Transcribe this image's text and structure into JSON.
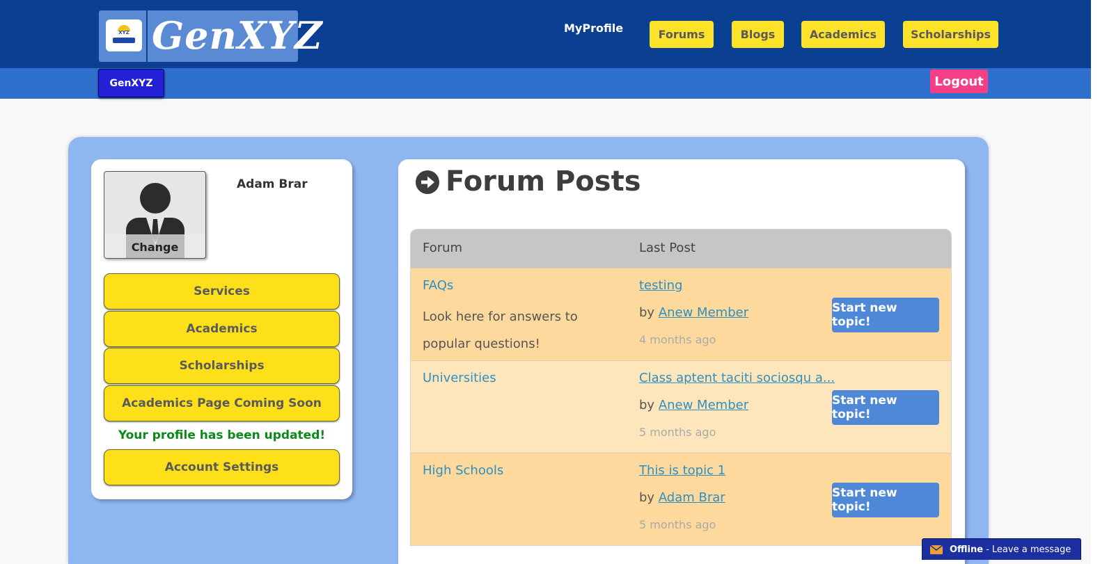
{
  "header": {
    "logo_text": "GenXYZ",
    "logo_badge_text": "XYZ",
    "nav_profile": "MyProfile",
    "nav_buttons": [
      "Forums",
      "Blogs",
      "Academics",
      "Scholarships"
    ],
    "home_button": "GenXYZ",
    "logout": "Logout"
  },
  "profile": {
    "name": "Adam Brar",
    "change_label": "Change",
    "menu": [
      "Services",
      "Academics",
      "Scholarships",
      "Academics Page Coming Soon"
    ],
    "status_message": "Your profile has been updated!",
    "settings_button": "Account Settings"
  },
  "forum": {
    "title": "Forum Posts",
    "columns": [
      "Forum",
      "Last Post"
    ],
    "rows": [
      {
        "name": "FAQs",
        "description": "Look here for answers to popular questions!",
        "last_post": "testing",
        "by_label": "by",
        "author": "Anew Member",
        "time": "4 months ago",
        "action": "Start new topic!"
      },
      {
        "name": "Universities",
        "description": "",
        "last_post": "Class aptent taciti sociosqu a...",
        "by_label": "by",
        "author": "Anew Member",
        "time": "5 months ago",
        "action": "Start new topic!"
      },
      {
        "name": "High Schools",
        "description": "",
        "last_post": "This is topic 1",
        "by_label": "by",
        "author": "Adam Brar",
        "time": "5 months ago",
        "action": "Start new topic!"
      }
    ]
  },
  "chat": {
    "status": "Offline",
    "message": "- Leave a message"
  },
  "colors": {
    "header": "#0a3f91",
    "subheader": "#2f6fce",
    "yellow": "#fde01a",
    "accent_pink": "#f43f86",
    "success": "#0a8a17"
  }
}
